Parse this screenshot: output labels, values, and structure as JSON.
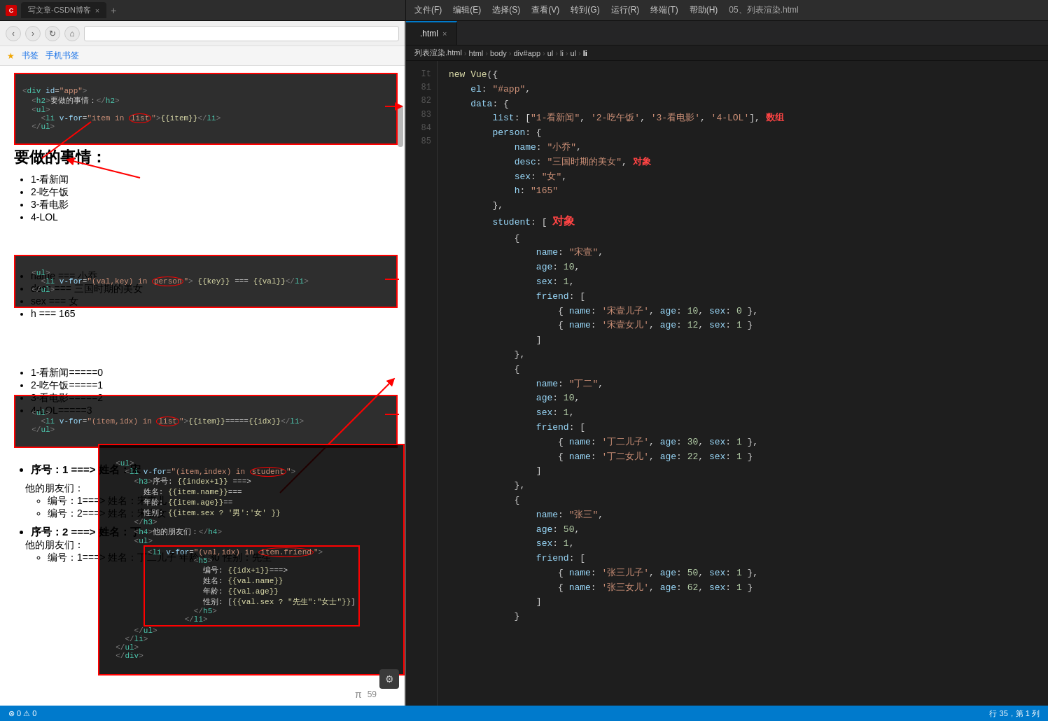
{
  "window": {
    "title": "写文章-CSDN博客",
    "tab_label": "写文章-CSDN博客"
  },
  "menu": {
    "items": [
      "文件(F)",
      "编辑(E)",
      "选择(S)",
      "查看(V)",
      "转到(G)",
      "运行(R)",
      "终端(T)",
      "帮助(H)",
      "05、列表渲染.html"
    ]
  },
  "editor": {
    "tab_label": ".html",
    "tab_close": "×",
    "breadcrumb": "列表渲染.html > html > body > div#app > ul > li > ul > li",
    "status_line": "行 35，第 1 列"
  },
  "status_bar": {
    "errors": "⊗ 0 ⚠ 0",
    "line_col": "行 35，第 1 列"
  },
  "browser": {
    "url": "",
    "bookmarks": [
      "书签",
      "手机书签"
    ]
  },
  "page": {
    "title": "要做的事情：",
    "list1": [
      "1-看新闻",
      "2-吃午饭",
      "3-看电影",
      "4-LOL"
    ],
    "list2_items": [
      "name === 小乔",
      "desc === 三国时期的美女",
      "sex === 女",
      "h === 165"
    ],
    "list3_items": [
      "1-看新闻=====0",
      "2-吃午饭=====1",
      "3-看电影=====2",
      "4-LOL=====3"
    ],
    "student_items": [
      "序号：1 ===> 姓名：宋",
      "序号：2 ===> 姓名：丁"
    ]
  },
  "code": {
    "vue_instance": "new Vue({\n    el: \"#app\",\n    data: {",
    "list_data": "        list: [\"1-看新闻\", '2-吃午饭', '3-看电影', '4-LOL'],",
    "person_data": "        person: {",
    "person_fields": "            name: \"小乔\",\n            desc: \"三国时期的美女\",\n            sex: \"女\",\n            h: \"165\"",
    "student_label": "student:",
    "student_data_lines": [
      "        {",
      "            name: \"宋壹\",",
      "            age: 10,",
      "            sex: 1,",
      "            friend: [",
      "                { name: '宋壹儿子', age: 10, sex: 0 },",
      "                { name: '宋壹女儿', age: 12, sex: 1 }",
      "            ]",
      "        },",
      "        {",
      "            name: \"丁二\",",
      "            age: 10,",
      "            sex: 1,",
      "            friend: [",
      "                { name: '丁二儿子', age: 30, sex: 1 },",
      "                { name: '丁二女儿', age: 22, sex: 1 }",
      "            ]",
      "        },",
      "        {",
      "            name: \"张三\",",
      "            age: 50,",
      "            sex: 1,",
      "            friend: [",
      "                { name: '张三儿子', age: 50, sex: 1 },",
      "                { name: '张三女儿', age: 62, sex: 1 }",
      "            ]",
      "        }"
    ]
  }
}
